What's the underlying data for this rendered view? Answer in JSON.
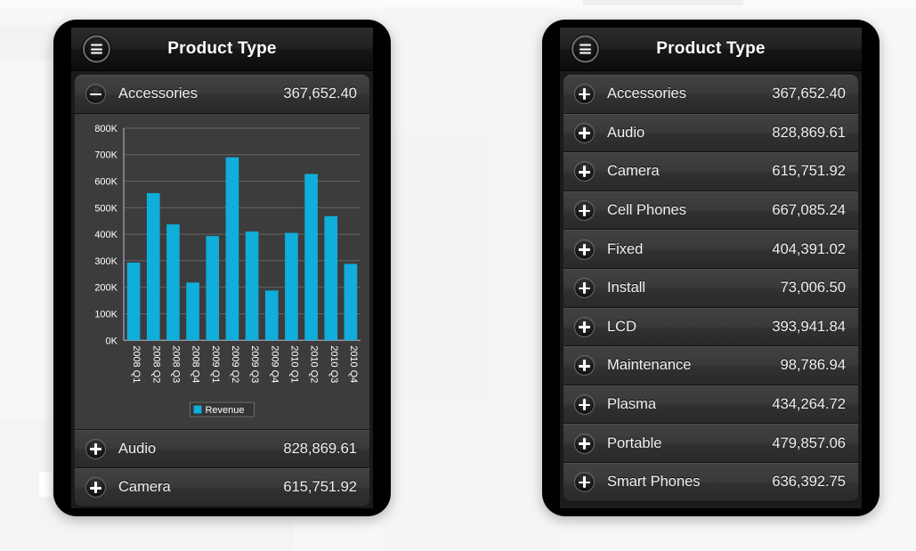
{
  "app": {
    "title": "Product Type",
    "menu_icon": "hamburger-menu-icon",
    "accent_color": "#0FAEDB",
    "panel_bg": "#3a3a3a",
    "row_text_color": "#f2f2f2"
  },
  "left_panel": {
    "header_title": "Product Type",
    "expanded_row": {
      "label": "Accessories",
      "value": "367,652.40",
      "toggle_icon": "minus-icon",
      "expanded": true
    },
    "collapsed_rows": [
      {
        "label": "Audio",
        "value": "828,869.61",
        "toggle_icon": "plus-icon"
      },
      {
        "label": "Camera",
        "value": "615,751.92",
        "toggle_icon": "plus-icon"
      }
    ]
  },
  "right_panel": {
    "header_title": "Product Type",
    "rows": [
      {
        "label": "Accessories",
        "value": "367,652.40",
        "toggle_icon": "plus-icon"
      },
      {
        "label": "Audio",
        "value": "828,869.61",
        "toggle_icon": "plus-icon"
      },
      {
        "label": "Camera",
        "value": "615,751.92",
        "toggle_icon": "plus-icon"
      },
      {
        "label": "Cell Phones",
        "value": "667,085.24",
        "toggle_icon": "plus-icon"
      },
      {
        "label": "Fixed",
        "value": "404,391.02",
        "toggle_icon": "plus-icon"
      },
      {
        "label": "Install",
        "value": "73,006.50",
        "toggle_icon": "plus-icon"
      },
      {
        "label": "LCD",
        "value": "393,941.84",
        "toggle_icon": "plus-icon"
      },
      {
        "label": "Maintenance",
        "value": "98,786.94",
        "toggle_icon": "plus-icon"
      },
      {
        "label": "Plasma",
        "value": "434,264.72",
        "toggle_icon": "plus-icon"
      },
      {
        "label": "Portable",
        "value": "479,857.06",
        "toggle_icon": "plus-icon"
      },
      {
        "label": "Smart Phones",
        "value": "636,392.75",
        "toggle_icon": "plus-icon"
      }
    ]
  },
  "chart_data": {
    "type": "bar",
    "title": "",
    "xlabel": "",
    "ylabel": "",
    "categories": [
      "2008 Q1",
      "2008 Q2",
      "2008 Q3",
      "2008 Q4",
      "2009 Q1",
      "2009 Q2",
      "2009 Q3",
      "2009 Q4",
      "2010 Q1",
      "2010 Q2",
      "2010 Q3",
      "2010 Q4"
    ],
    "series": [
      {
        "name": "Revenue",
        "color": "#0FAEDB",
        "values": [
          293000,
          555000,
          437000,
          218000,
          393000,
          690000,
          410000,
          188000,
          405000,
          627000,
          468000,
          288000
        ]
      }
    ],
    "ylim": [
      0,
      800000
    ],
    "ytick_values": [
      0,
      100000,
      200000,
      300000,
      400000,
      500000,
      600000,
      700000,
      800000
    ],
    "ytick_labels": [
      "0K",
      "100K",
      "200K",
      "300K",
      "400K",
      "500K",
      "600K",
      "700K",
      "800K"
    ],
    "grid": true,
    "legend_position": "bottom",
    "legend_entries": [
      "Revenue"
    ],
    "plot_bg": "#3c3c3c",
    "axis_color": "#9b97a8",
    "gridline_color": "#6d6d6d",
    "tick_label_color": "#ffffff",
    "xtick_rotation_deg": 90
  }
}
